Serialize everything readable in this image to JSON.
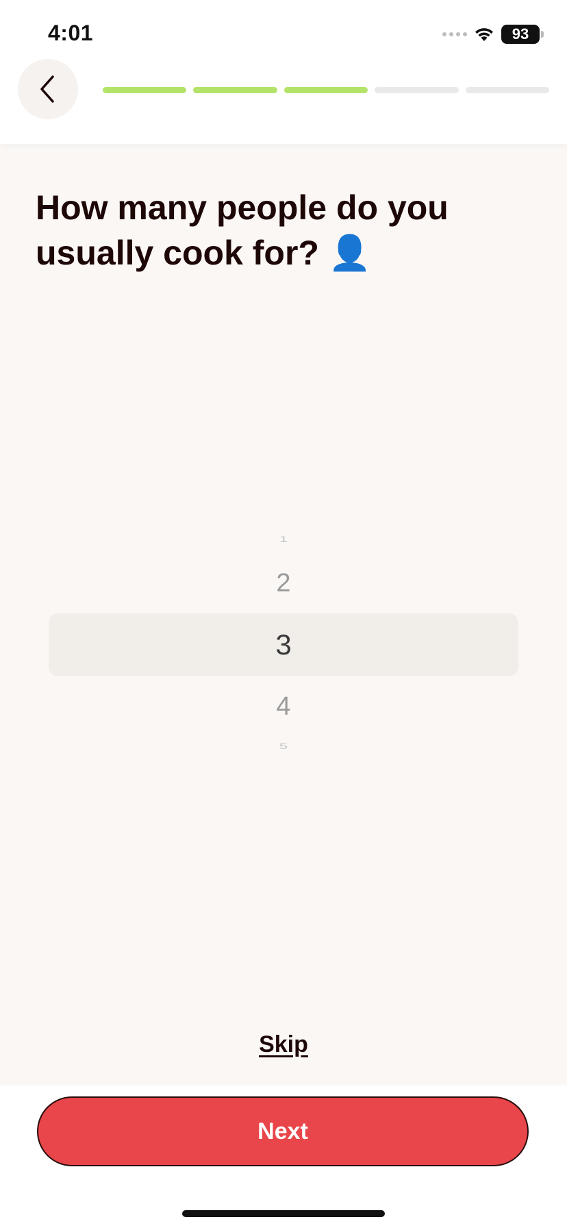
{
  "status_bar": {
    "time": "4:01",
    "battery": "93",
    "icons": [
      "cellular-signal-icon",
      "wifi-icon",
      "battery-icon"
    ]
  },
  "nav": {
    "back_icon": "chevron-left-icon",
    "progress": {
      "total_steps": 5,
      "completed_steps": 3
    }
  },
  "question": {
    "text": "How many people do you usually cook for?",
    "emoji": "👤"
  },
  "picker": {
    "options": [
      "1",
      "2",
      "3",
      "4",
      "5"
    ],
    "selected": "3"
  },
  "actions": {
    "skip_label": "Skip",
    "next_label": "Next"
  },
  "colors": {
    "progress_done": "#b4e36a",
    "progress_todo": "#e9e9e9",
    "primary_button": "#e8464a",
    "text_dark": "#1e0707",
    "background": "#faf7f5"
  }
}
